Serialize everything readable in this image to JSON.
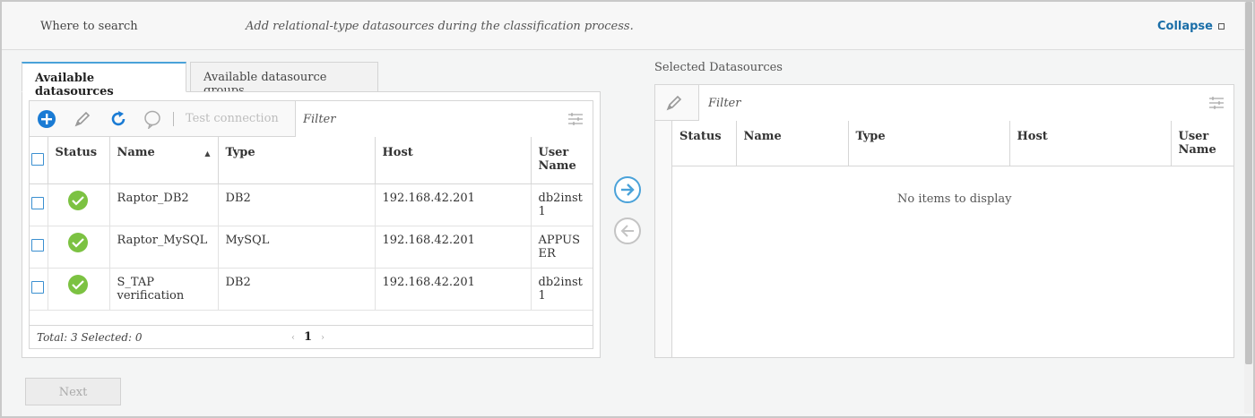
{
  "header": {
    "where_label": "Where to search",
    "hint": "Add relational-type datasources during the classification process.",
    "collapse_label": "Collapse"
  },
  "tabs": [
    {
      "label": "Available datasources",
      "active": true
    },
    {
      "label": "Available datasource groups",
      "active": false
    }
  ],
  "left_toolbar": {
    "icons": [
      "add-icon",
      "edit-icon",
      "refresh-icon",
      "test-bubble-icon"
    ],
    "test_connection_label": "Test connection",
    "filter_placeholder": "Filter"
  },
  "left_table": {
    "columns": [
      "Status",
      "Name",
      "Type",
      "Host",
      "User Name"
    ],
    "sorted_column": "Name",
    "rows": [
      {
        "status": "ok",
        "name": "Raptor_DB2",
        "type": "DB2",
        "host": "192.168.42.201",
        "user": "db2inst1"
      },
      {
        "status": "ok",
        "name": "Raptor_MySQL",
        "type": "MySQL",
        "host": "192.168.42.201",
        "user": "APPUSER"
      },
      {
        "status": "ok",
        "name": "S_TAP verification",
        "type": "DB2",
        "host": "192.168.42.201",
        "user": "db2inst1"
      }
    ],
    "total_text": "Total: 3 Selected: 0",
    "page": "1"
  },
  "right_section": {
    "title": "Selected Datasources",
    "filter_placeholder": "Filter",
    "columns": [
      "Status",
      "Name",
      "Type",
      "Host",
      "User Name"
    ],
    "empty_text": "No items to display"
  },
  "footer": {
    "next_label": "Next"
  },
  "colors": {
    "accent": "#4aa2d9",
    "link": "#1a6ea8",
    "status_ok": "#7cc242"
  }
}
